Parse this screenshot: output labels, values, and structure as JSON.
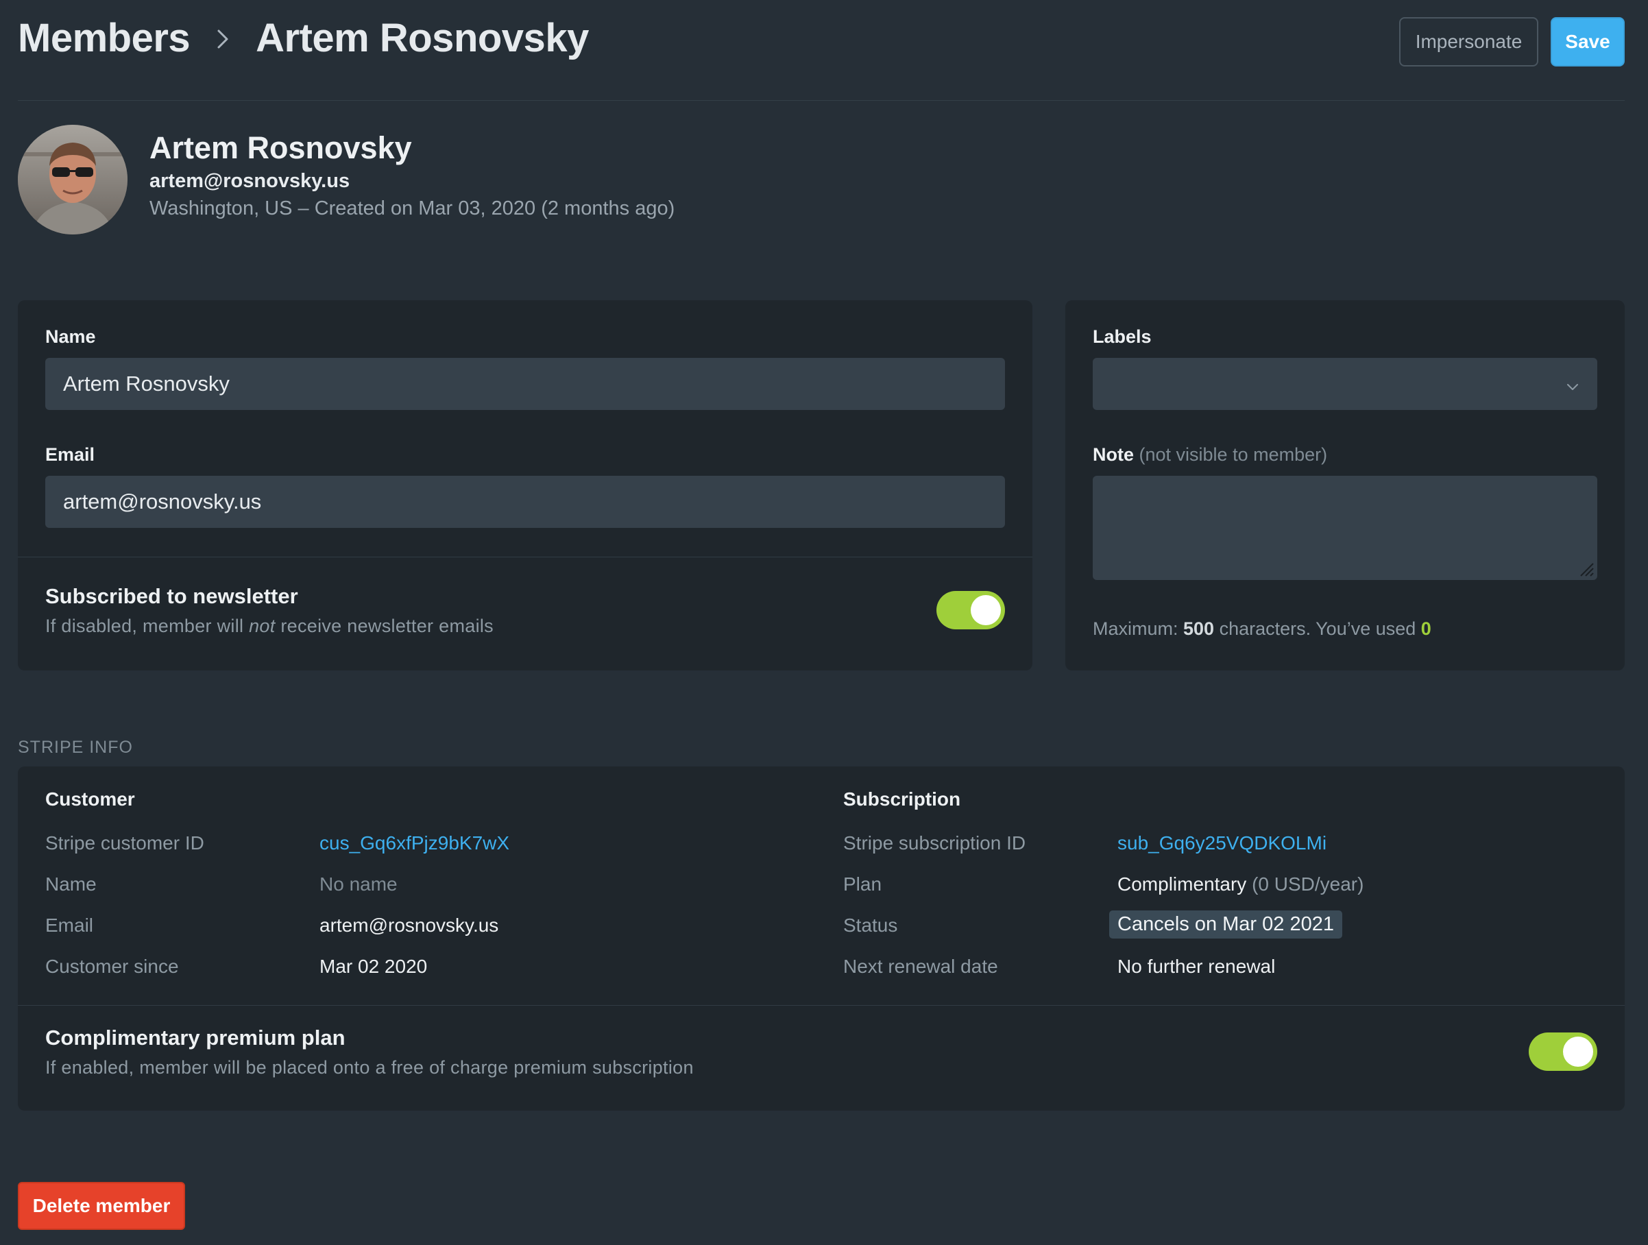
{
  "header": {
    "breadcrumb_parent": "Members",
    "breadcrumb_current": "Artem Rosnovsky",
    "impersonate_label": "Impersonate",
    "save_label": "Save"
  },
  "profile": {
    "name": "Artem Rosnovsky",
    "email": "artem@rosnovsky.us",
    "meta": "Washington, US – Created on Mar 03, 2020 (2 months ago)"
  },
  "member_form": {
    "name_label": "Name",
    "name_value": "Artem Rosnovsky",
    "email_label": "Email",
    "email_value": "artem@rosnovsky.us",
    "newsletter_title": "Subscribed to newsletter",
    "newsletter_desc_before": "If disabled, member will ",
    "newsletter_desc_em": "not",
    "newsletter_desc_after": " receive newsletter emails",
    "newsletter_enabled": true
  },
  "side_form": {
    "labels_label": "Labels",
    "labels_value": "",
    "note_label": "Note",
    "note_hint": "(not visible to member)",
    "note_value": "",
    "count_prefix": "Maximum: ",
    "count_max": "500",
    "count_middle": " characters. You’ve used ",
    "count_used": "0"
  },
  "stripe": {
    "section_title": "STRIPE INFO",
    "customer": {
      "title": "Customer",
      "rows": [
        {
          "key": "Stripe customer ID",
          "value": "cus_Gq6xfPjz9bK7wX"
        },
        {
          "key": "Name",
          "value": "No name"
        },
        {
          "key": "Email",
          "value": "artem@rosnovsky.us"
        },
        {
          "key": "Customer since",
          "value": "Mar 02 2020"
        }
      ]
    },
    "subscription": {
      "title": "Subscription",
      "id_key": "Stripe subscription ID",
      "id_value": "sub_Gq6y25VQDKOLMi",
      "plan_key": "Plan",
      "plan_value": "Complimentary",
      "plan_price": "(0 USD/year)",
      "status_key": "Status",
      "status_value": "Cancels on Mar 02 2021",
      "renewal_key": "Next renewal date",
      "renewal_value": "No further renewal"
    },
    "comp_title": "Complimentary premium plan",
    "comp_desc": "If enabled, member will be placed onto a free of charge premium subscription",
    "comp_enabled": true
  },
  "actions": {
    "delete_label": "Delete member"
  },
  "colors": {
    "background": "#262f37",
    "card": "#1f262c",
    "accent_blue": "#3eb0ef",
    "toggle_green": "#9fcf3a",
    "danger": "#e6422a"
  },
  "icons": [
    "chevron-right-icon",
    "chevron-down-icon",
    "resize-grip-icon",
    "avatar-photo"
  ]
}
